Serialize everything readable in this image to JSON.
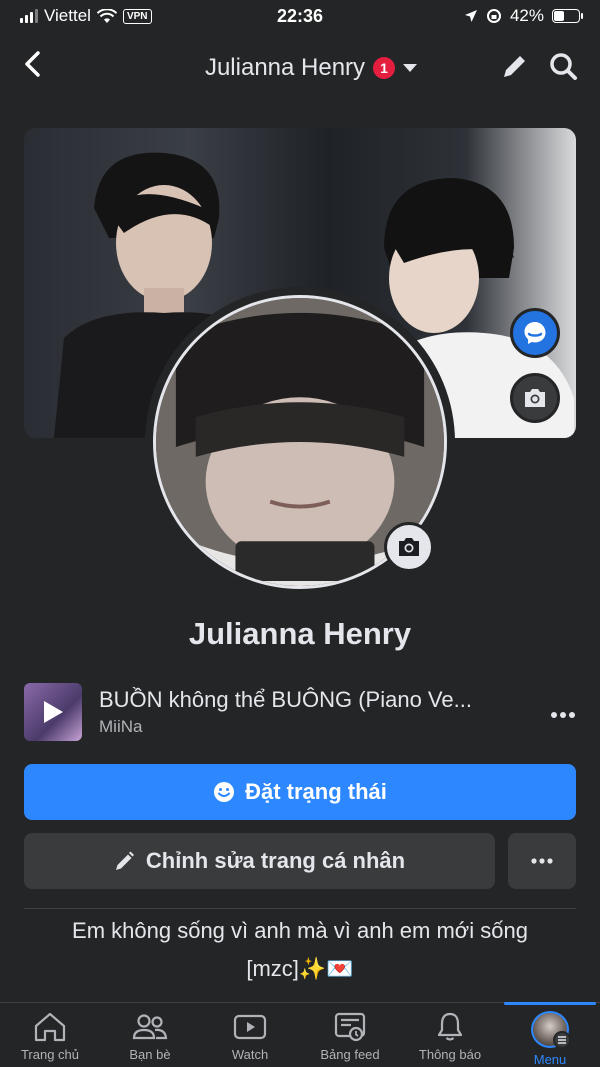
{
  "status_bar": {
    "carrier": "Viettel",
    "vpn": "VPN",
    "time": "22:36",
    "battery": "42%",
    "battery_level": 0.42
  },
  "header": {
    "title": "Julianna Henry",
    "notification_count": "1"
  },
  "profile": {
    "name": "Julianna Henry"
  },
  "music": {
    "title": "BUỒN không thể BUÔNG (Piano Ve...",
    "artist": "MiiNa"
  },
  "actions": {
    "set_status": "Đặt trạng thái",
    "edit_profile": "Chỉnh sửa trang cá nhân"
  },
  "bio": {
    "line1": "Em không sống vì anh mà vì anh em mới sống",
    "line2": "[mzc]✨💌"
  },
  "bottom_nav": [
    {
      "label": "Trang chủ",
      "icon": "home-icon"
    },
    {
      "label": "Bạn bè",
      "icon": "friends-icon"
    },
    {
      "label": "Watch",
      "icon": "watch-icon"
    },
    {
      "label": "Bảng feed",
      "icon": "feed-icon"
    },
    {
      "label": "Thông báo",
      "icon": "bell-icon"
    },
    {
      "label": "Menu",
      "icon": "menu-avatar-icon"
    }
  ],
  "colors": {
    "background": "#242526",
    "accent": "#2d88ff",
    "badge": "#e41e3f"
  }
}
